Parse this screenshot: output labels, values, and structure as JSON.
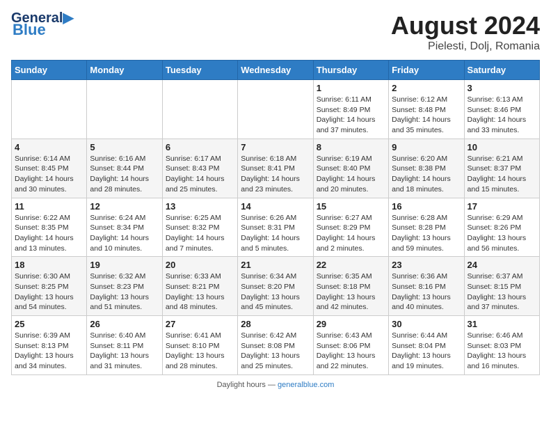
{
  "title": "August 2024",
  "subtitle": "Pielesti, Dolj, Romania",
  "logo": {
    "line1": "General",
    "line2": "Blue"
  },
  "days_of_week": [
    "Sunday",
    "Monday",
    "Tuesday",
    "Wednesday",
    "Thursday",
    "Friday",
    "Saturday"
  ],
  "weeks": [
    [
      {
        "day": "",
        "info": ""
      },
      {
        "day": "",
        "info": ""
      },
      {
        "day": "",
        "info": ""
      },
      {
        "day": "",
        "info": ""
      },
      {
        "day": "1",
        "info": "Sunrise: 6:11 AM\nSunset: 8:49 PM\nDaylight: 14 hours and 37 minutes."
      },
      {
        "day": "2",
        "info": "Sunrise: 6:12 AM\nSunset: 8:48 PM\nDaylight: 14 hours and 35 minutes."
      },
      {
        "day": "3",
        "info": "Sunrise: 6:13 AM\nSunset: 8:46 PM\nDaylight: 14 hours and 33 minutes."
      }
    ],
    [
      {
        "day": "4",
        "info": "Sunrise: 6:14 AM\nSunset: 8:45 PM\nDaylight: 14 hours and 30 minutes."
      },
      {
        "day": "5",
        "info": "Sunrise: 6:16 AM\nSunset: 8:44 PM\nDaylight: 14 hours and 28 minutes."
      },
      {
        "day": "6",
        "info": "Sunrise: 6:17 AM\nSunset: 8:43 PM\nDaylight: 14 hours and 25 minutes."
      },
      {
        "day": "7",
        "info": "Sunrise: 6:18 AM\nSunset: 8:41 PM\nDaylight: 14 hours and 23 minutes."
      },
      {
        "day": "8",
        "info": "Sunrise: 6:19 AM\nSunset: 8:40 PM\nDaylight: 14 hours and 20 minutes."
      },
      {
        "day": "9",
        "info": "Sunrise: 6:20 AM\nSunset: 8:38 PM\nDaylight: 14 hours and 18 minutes."
      },
      {
        "day": "10",
        "info": "Sunrise: 6:21 AM\nSunset: 8:37 PM\nDaylight: 14 hours and 15 minutes."
      }
    ],
    [
      {
        "day": "11",
        "info": "Sunrise: 6:22 AM\nSunset: 8:35 PM\nDaylight: 14 hours and 13 minutes."
      },
      {
        "day": "12",
        "info": "Sunrise: 6:24 AM\nSunset: 8:34 PM\nDaylight: 14 hours and 10 minutes."
      },
      {
        "day": "13",
        "info": "Sunrise: 6:25 AM\nSunset: 8:32 PM\nDaylight: 14 hours and 7 minutes."
      },
      {
        "day": "14",
        "info": "Sunrise: 6:26 AM\nSunset: 8:31 PM\nDaylight: 14 hours and 5 minutes."
      },
      {
        "day": "15",
        "info": "Sunrise: 6:27 AM\nSunset: 8:29 PM\nDaylight: 14 hours and 2 minutes."
      },
      {
        "day": "16",
        "info": "Sunrise: 6:28 AM\nSunset: 8:28 PM\nDaylight: 13 hours and 59 minutes."
      },
      {
        "day": "17",
        "info": "Sunrise: 6:29 AM\nSunset: 8:26 PM\nDaylight: 13 hours and 56 minutes."
      }
    ],
    [
      {
        "day": "18",
        "info": "Sunrise: 6:30 AM\nSunset: 8:25 PM\nDaylight: 13 hours and 54 minutes."
      },
      {
        "day": "19",
        "info": "Sunrise: 6:32 AM\nSunset: 8:23 PM\nDaylight: 13 hours and 51 minutes."
      },
      {
        "day": "20",
        "info": "Sunrise: 6:33 AM\nSunset: 8:21 PM\nDaylight: 13 hours and 48 minutes."
      },
      {
        "day": "21",
        "info": "Sunrise: 6:34 AM\nSunset: 8:20 PM\nDaylight: 13 hours and 45 minutes."
      },
      {
        "day": "22",
        "info": "Sunrise: 6:35 AM\nSunset: 8:18 PM\nDaylight: 13 hours and 42 minutes."
      },
      {
        "day": "23",
        "info": "Sunrise: 6:36 AM\nSunset: 8:16 PM\nDaylight: 13 hours and 40 minutes."
      },
      {
        "day": "24",
        "info": "Sunrise: 6:37 AM\nSunset: 8:15 PM\nDaylight: 13 hours and 37 minutes."
      }
    ],
    [
      {
        "day": "25",
        "info": "Sunrise: 6:39 AM\nSunset: 8:13 PM\nDaylight: 13 hours and 34 minutes."
      },
      {
        "day": "26",
        "info": "Sunrise: 6:40 AM\nSunset: 8:11 PM\nDaylight: 13 hours and 31 minutes."
      },
      {
        "day": "27",
        "info": "Sunrise: 6:41 AM\nSunset: 8:10 PM\nDaylight: 13 hours and 28 minutes."
      },
      {
        "day": "28",
        "info": "Sunrise: 6:42 AM\nSunset: 8:08 PM\nDaylight: 13 hours and 25 minutes."
      },
      {
        "day": "29",
        "info": "Sunrise: 6:43 AM\nSunset: 8:06 PM\nDaylight: 13 hours and 22 minutes."
      },
      {
        "day": "30",
        "info": "Sunrise: 6:44 AM\nSunset: 8:04 PM\nDaylight: 13 hours and 19 minutes."
      },
      {
        "day": "31",
        "info": "Sunrise: 6:46 AM\nSunset: 8:03 PM\nDaylight: 13 hours and 16 minutes."
      }
    ]
  ],
  "footer": "Daylight hours",
  "footer_url": "https://www.generalblue.com"
}
